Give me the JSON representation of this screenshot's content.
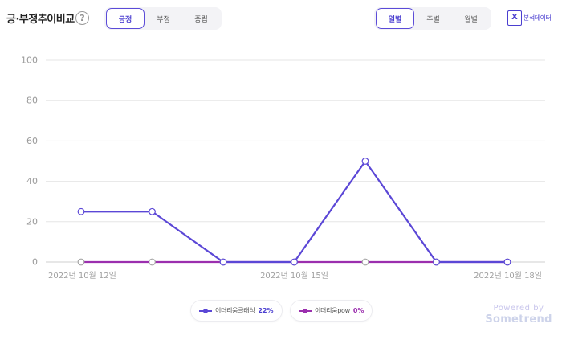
{
  "header": {
    "title": "긍·부정추이비교",
    "help_glyph": "?",
    "sentiment_tabs": [
      {
        "label": "긍정",
        "active": true
      },
      {
        "label": "부정",
        "active": false
      },
      {
        "label": "중립",
        "active": false
      }
    ],
    "period_tabs": [
      {
        "label": "일별",
        "active": true
      },
      {
        "label": "주별",
        "active": false
      },
      {
        "label": "월별",
        "active": false
      }
    ],
    "export_label": "분석데이터",
    "export_icon": "excel-icon",
    "export_glyph": "X"
  },
  "chart_data": {
    "type": "line",
    "x": [
      "2022-10-12",
      "2022-10-13",
      "2022-10-14",
      "2022-10-15",
      "2022-10-16",
      "2022-10-17",
      "2022-10-18"
    ],
    "x_tick_labels": [
      "2022년 10월 12일",
      "2022년 10월 15일",
      "2022년 10월 18일"
    ],
    "y_ticks": [
      0,
      20,
      40,
      60,
      80,
      100
    ],
    "ylim": [
      0,
      100
    ],
    "grid": true,
    "series": [
      {
        "name": "이더리움클래식",
        "values": [
          25,
          25,
          0,
          0,
          50,
          0,
          0
        ],
        "color": "#5b47d6"
      },
      {
        "name": "이더리움pow",
        "values": [
          0,
          0,
          0,
          0,
          0,
          0,
          0
        ],
        "color": "#9b2fae"
      }
    ]
  },
  "legend": [
    {
      "name": "이더리움클래식",
      "share": "22%",
      "color": "#5b47d6"
    },
    {
      "name": "이더리움pow",
      "share": "0%",
      "color": "#9b2fae"
    }
  ],
  "watermark": {
    "line1": "Powered by",
    "line2": "Sometrend"
  }
}
